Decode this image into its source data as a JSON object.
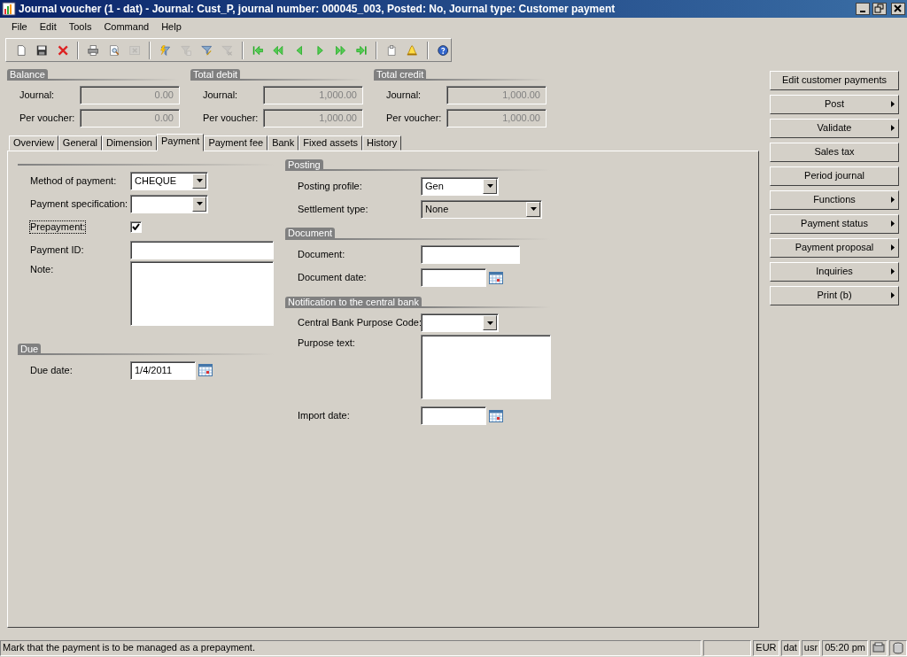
{
  "window": {
    "title": "Journal voucher (1 - dat) - Journal: Cust_P, journal number: 000045_003, Posted: No, Journal type: Customer payment"
  },
  "menu": [
    {
      "label": "File"
    },
    {
      "label": "Edit"
    },
    {
      "label": "Tools"
    },
    {
      "label": "Command"
    },
    {
      "label": "Help"
    }
  ],
  "toolbar": [
    {
      "kind": "new",
      "disabled": false
    },
    {
      "kind": "save",
      "disabled": false
    },
    {
      "kind": "delete",
      "disabled": false
    },
    {
      "kind": "sep"
    },
    {
      "kind": "print",
      "disabled": false
    },
    {
      "kind": "preview",
      "disabled": false
    },
    {
      "kind": "sheet",
      "disabled": true
    },
    {
      "kind": "sep"
    },
    {
      "kind": "filter-bolt",
      "disabled": false
    },
    {
      "kind": "filter-grid",
      "disabled": true
    },
    {
      "kind": "filter-pen",
      "disabled": false
    },
    {
      "kind": "filter-x",
      "disabled": true
    },
    {
      "kind": "sep"
    },
    {
      "kind": "first",
      "disabled": false
    },
    {
      "kind": "rewind",
      "disabled": false
    },
    {
      "kind": "prev",
      "disabled": false
    },
    {
      "kind": "next",
      "disabled": false
    },
    {
      "kind": "forward",
      "disabled": false
    },
    {
      "kind": "last",
      "disabled": false
    },
    {
      "kind": "sep"
    },
    {
      "kind": "clip",
      "disabled": false
    },
    {
      "kind": "bell",
      "disabled": false
    },
    {
      "kind": "sep"
    },
    {
      "kind": "help",
      "disabled": false
    }
  ],
  "summary": [
    {
      "title": "Balance",
      "rows": [
        {
          "label": "Journal:",
          "value": "0.00",
          "disabled": true
        },
        {
          "label": "Per voucher:",
          "value": "0.00",
          "disabled": true
        }
      ]
    },
    {
      "title": "Total debit",
      "rows": [
        {
          "label": "Journal:",
          "value": "1,000.00",
          "disabled": true
        },
        {
          "label": "Per voucher:",
          "value": "1,000.00",
          "disabled": true
        }
      ]
    },
    {
      "title": "Total credit",
      "rows": [
        {
          "label": "Journal:",
          "value": "1,000.00",
          "disabled": true
        },
        {
          "label": "Per voucher:",
          "value": "1,000.00",
          "disabled": true
        }
      ]
    }
  ],
  "tabs": [
    {
      "label": "Overview",
      "selected": false
    },
    {
      "label": "General",
      "selected": false
    },
    {
      "label": "Dimension",
      "selected": false
    },
    {
      "label": "Payment",
      "selected": true
    },
    {
      "label": "Payment fee",
      "selected": false
    },
    {
      "label": "Bank",
      "selected": false
    },
    {
      "label": "Fixed assets",
      "selected": false
    },
    {
      "label": "History",
      "selected": false
    }
  ],
  "left_groups": [
    {
      "fields": [
        {
          "kind": "combo",
          "label": "Method of payment:",
          "value": "CHEQUE"
        },
        {
          "kind": "combo",
          "label": "Payment specification:"
        },
        {
          "kind": "check",
          "label": "Prepayment:",
          "checked": true,
          "focused": true
        },
        {
          "kind": "text",
          "label": "Payment ID:"
        },
        {
          "kind": "textarea",
          "label": "Note:"
        }
      ]
    },
    {
      "title": "Due",
      "fields": [
        {
          "kind": "date",
          "label": "Due date:",
          "value": "1/4/2011"
        }
      ]
    }
  ],
  "right_groups": [
    {
      "title": "Posting",
      "fields": [
        {
          "kind": "combo",
          "label": "Posting profile:",
          "value": "Gen"
        },
        {
          "kind": "wide-combo",
          "label": "Settlement type:",
          "value": "None"
        }
      ]
    },
    {
      "title": "Document",
      "fields": [
        {
          "kind": "text",
          "label": "Document:"
        },
        {
          "kind": "date",
          "label": "Document date:"
        }
      ]
    },
    {
      "title": "Notification to the central bank",
      "fields": [
        {
          "kind": "combo",
          "label": "Central Bank Purpose Code:"
        },
        {
          "kind": "textarea",
          "label": "Purpose text:"
        },
        {
          "kind": "date",
          "label": "Import date:"
        }
      ]
    }
  ],
  "buttons": [
    {
      "label": "Edit customer payments",
      "submenu": false
    },
    {
      "label": "Post",
      "submenu": true
    },
    {
      "label": "Validate",
      "submenu": true
    },
    {
      "label": "Sales tax",
      "submenu": false
    },
    {
      "label": "Period journal",
      "submenu": false
    },
    {
      "label": "Functions",
      "submenu": true
    },
    {
      "label": "Payment status",
      "submenu": true
    },
    {
      "label": "Payment proposal",
      "submenu": true
    },
    {
      "label": "Inquiries",
      "submenu": true
    },
    {
      "label": "Print (b)",
      "submenu": true
    }
  ],
  "status_bar": {
    "message": "Mark that the payment is to be managed as a prepayment.",
    "cells": [
      "EUR",
      "dat",
      "usr",
      "05:20 pm"
    ]
  }
}
